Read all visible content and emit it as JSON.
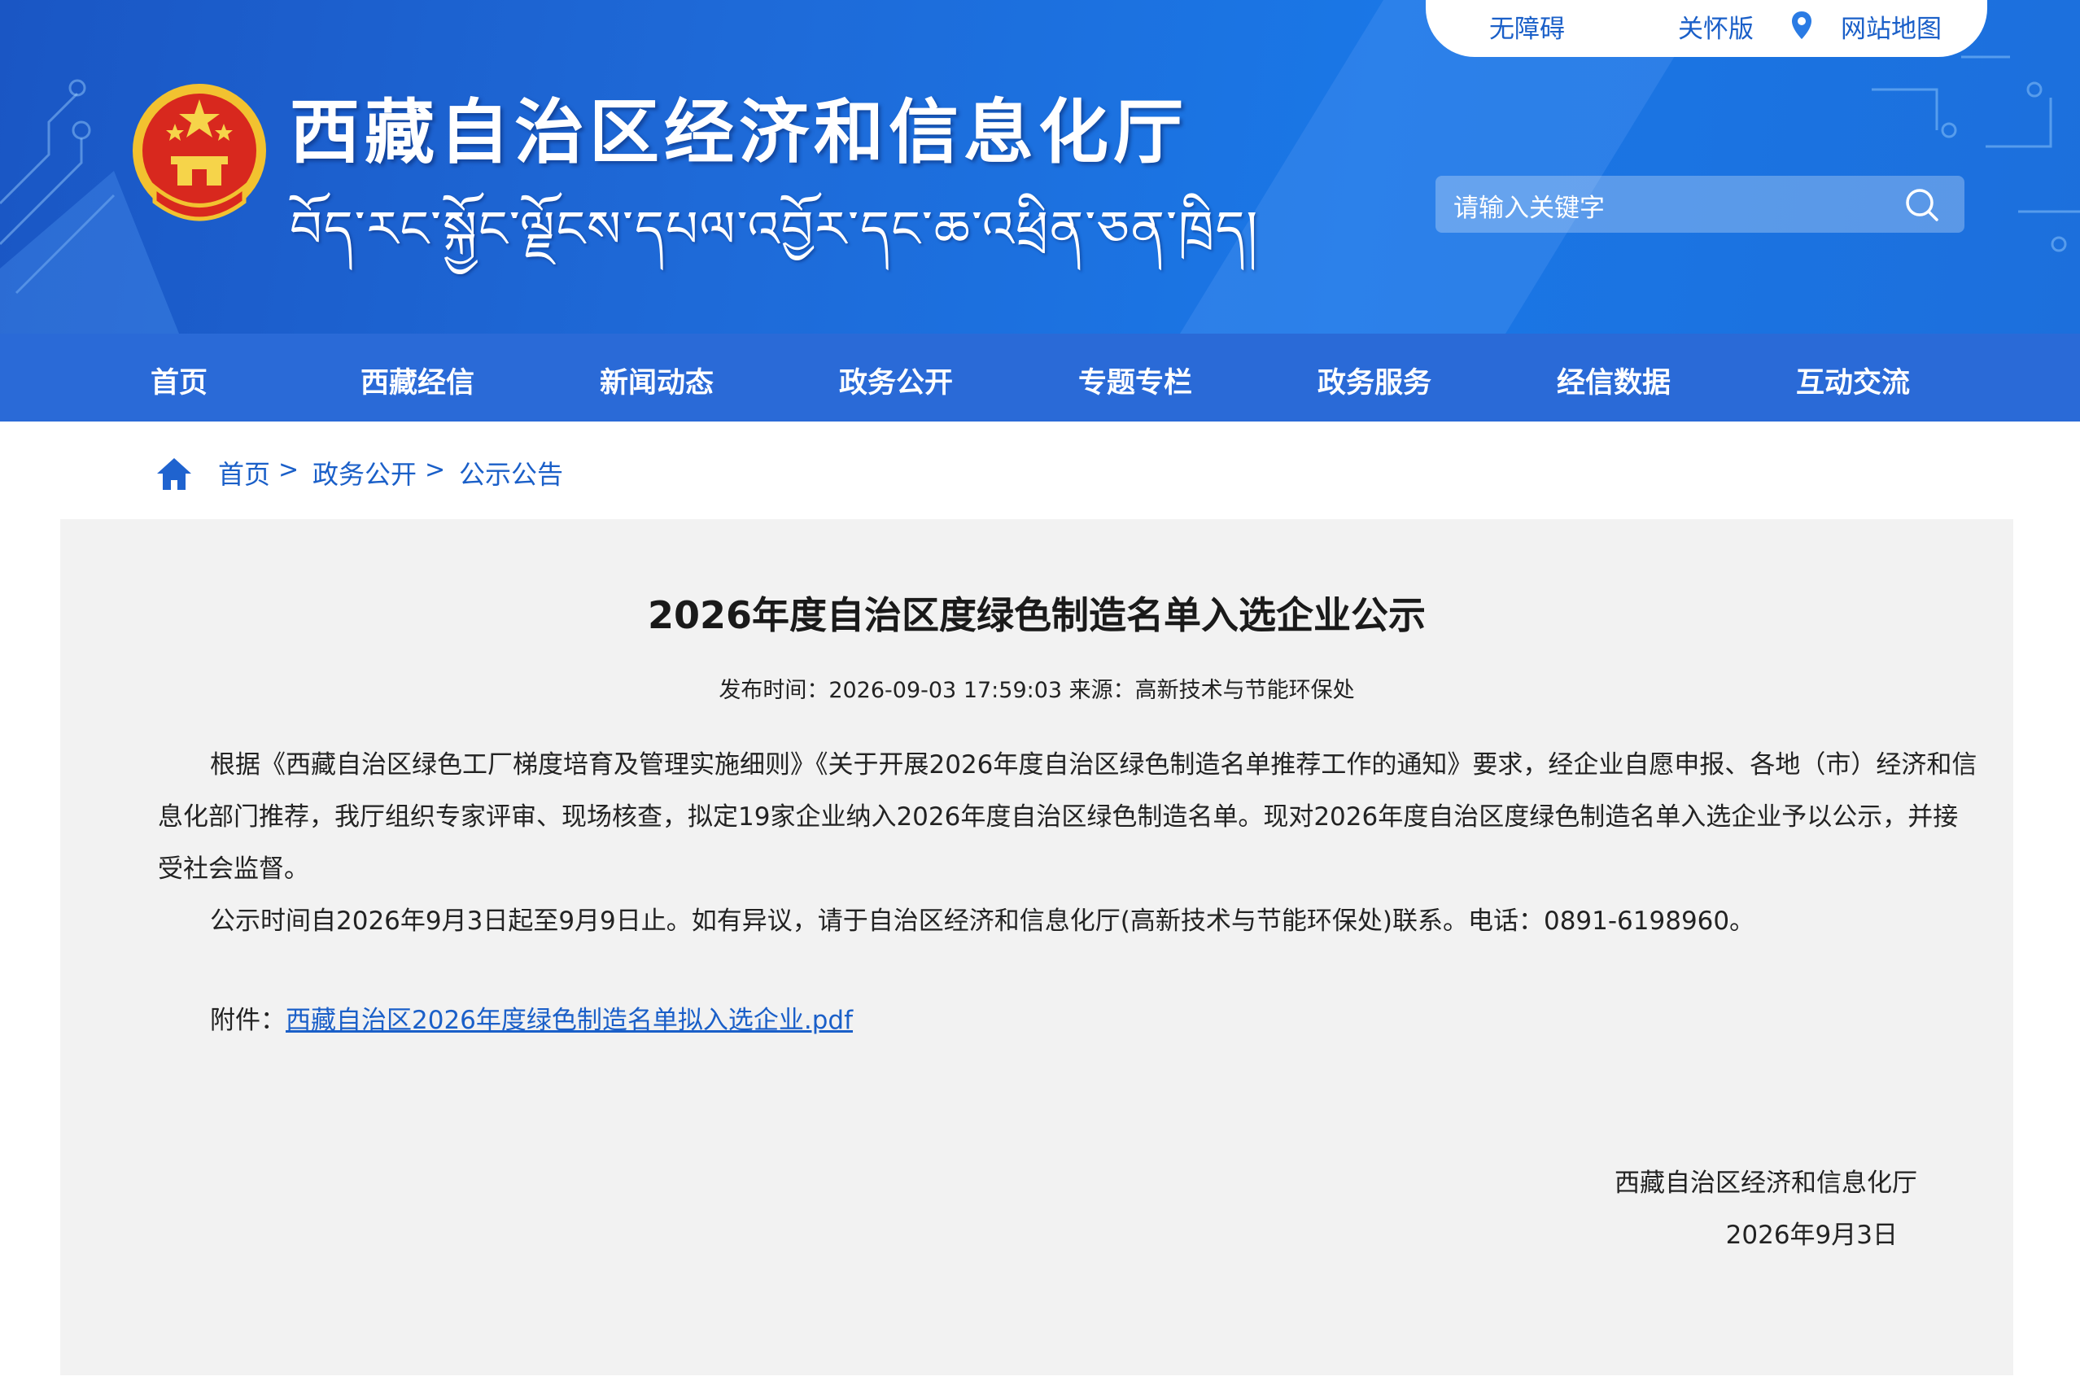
{
  "header": {
    "site_title": "西藏自治区经济和信息化厅",
    "site_subtitle_tibetan": "བོད་རང་སྐྱོང་ལྗོངས་དཔལ་འབྱོར་དང་ཆ་འཕྲིན་ཅན་ཁྲིད།",
    "top_links": [
      "无障碍",
      "关怀版",
      "网站地图"
    ],
    "search_placeholder": "请输入关键字"
  },
  "nav": {
    "items": [
      "首页",
      "西藏经信",
      "新闻动态",
      "政务公开",
      "专题专栏",
      "政务服务",
      "经信数据",
      "互动交流"
    ]
  },
  "breadcrumb": {
    "items": [
      "首页",
      "政务公开",
      "公示公告"
    ],
    "separator": ">"
  },
  "article": {
    "title": "2026年度自治区度绿色制造名单入选企业公示",
    "meta": "发布时间：2026-09-03 17:59:03 来源：高新技术与节能环保处",
    "paragraphs": [
      "根据《西藏自治区绿色工厂梯度培育及管理实施细则》《关于开展2026年度自治区绿色制造名单推荐工作的通知》要求，经企业自愿申报、各地（市）经济和信息化部门推荐，我厅组织专家评审、现场核查，拟定19家企业纳入2026年度自治区绿色制造名单。现对2026年度自治区度绿色制造名单入选企业予以公示，并接受社会监督。",
      "公示时间自2026年9月3日起至9月9日止。如有异议，请于自治区经济和信息化厅(高新技术与节能环保处)联系。电话：0891-6198960。"
    ],
    "attachment_label": "附件：",
    "attachment_link": "西藏自治区2026年度绿色制造名单拟入选企业.pdf",
    "signature_org": "西藏自治区经济和信息化厅",
    "signature_date": "2026年9月3日"
  },
  "colors": {
    "banner": "#1e6ad8",
    "nav": "#2a6ad7",
    "link": "#1a5fc8",
    "article_bg": "#f2f2f2"
  }
}
